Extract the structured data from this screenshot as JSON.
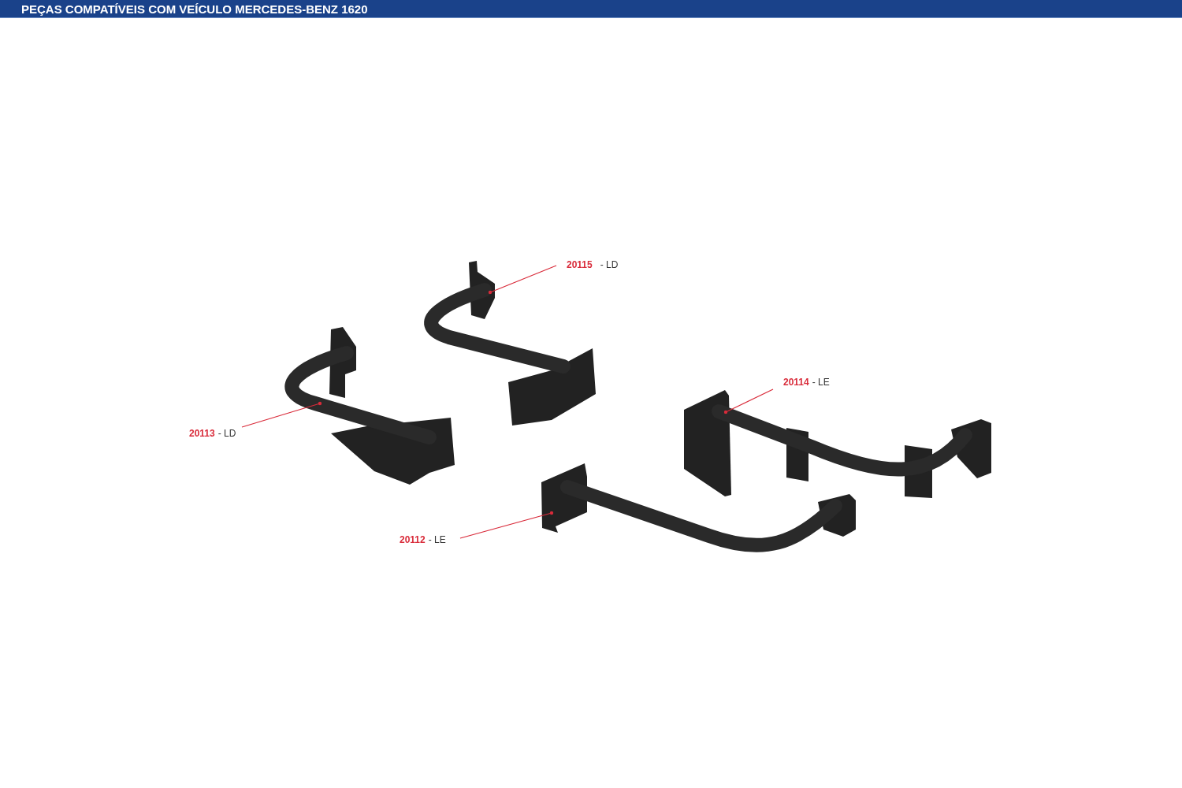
{
  "header": {
    "title": "PEÇAS COMPATÍVEIS COM VEÍCULO MERCEDES-BENZ 1620"
  },
  "callouts": [
    {
      "part_number": "20115",
      "side": "- LD"
    },
    {
      "part_number": "20113",
      "side": "- LD"
    },
    {
      "part_number": "20114",
      "side": "- LE"
    },
    {
      "part_number": "20112",
      "side": "- LE"
    }
  ]
}
